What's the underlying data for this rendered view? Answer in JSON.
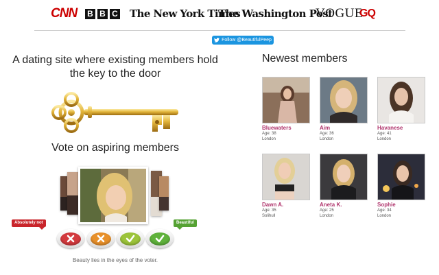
{
  "press": {
    "cnn": "CNN",
    "bbc": [
      "B",
      "B",
      "C"
    ],
    "nyt": "The New York Times",
    "wp": "The Washington Post",
    "vogue": "VOGUE",
    "gq": "GQ"
  },
  "follow": {
    "label": "Follow @BeautifulPeep",
    "icon": "twitter-bird-icon"
  },
  "left": {
    "headline": "A dating site where existing members hold the key to the door",
    "key_icon": "golden-key",
    "vote_title": "Vote on aspiring members",
    "badge_negative": "Absolutely not",
    "badge_positive": "Beautiful",
    "vote_buttons": [
      {
        "icon": "cross-icon",
        "color": "#d33a3e"
      },
      {
        "icon": "cross-icon",
        "color": "#e8902a"
      },
      {
        "icon": "check-icon",
        "color": "#9cc43a"
      },
      {
        "icon": "check-icon",
        "color": "#5fb23b"
      }
    ],
    "caption": "Beauty lies in the eyes of the voter."
  },
  "right": {
    "title": "Newest members",
    "members": [
      {
        "name": "Bluewaters",
        "age": "Age: 38",
        "city": "London"
      },
      {
        "name": "Aim",
        "age": "Age: 36",
        "city": "London"
      },
      {
        "name": "Havanese",
        "age": "Age: 41",
        "city": "London"
      },
      {
        "name": "Dawn A.",
        "age": "Age: 35",
        "city": "Solihull"
      },
      {
        "name": "Aneta K.",
        "age": "Age: 25",
        "city": "London"
      },
      {
        "name": "Sophie",
        "age": "Age: 34",
        "city": "London"
      }
    ]
  },
  "colors": {
    "member_name": "#b0356d",
    "follow_button": "#1b95e0",
    "negative": "#c9252b",
    "positive": "#55a233",
    "key_gold": "#d9a92a"
  }
}
